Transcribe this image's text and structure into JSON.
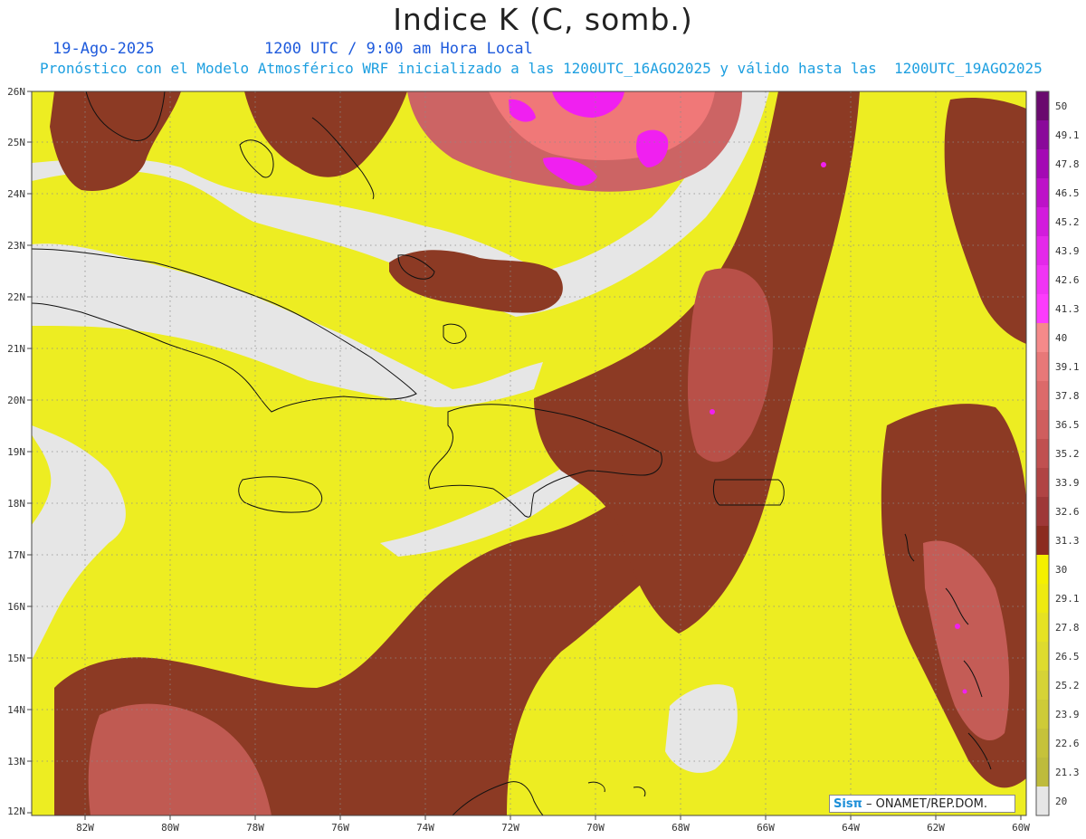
{
  "header": {
    "title": "Indice K (C, somb.)",
    "date": "19-Ago-2025",
    "time": "1200 UTC / 9:00 am Hora Local",
    "forecast_line": "Pronóstico con el Modelo Atmosférico WRF inicializado a las 1200UTC_16AGO2025 y válido hasta las  1200UTC_19AGO2025"
  },
  "axes": {
    "latitudes": [
      "26N",
      "25N",
      "24N",
      "23N",
      "22N",
      "21N",
      "20N",
      "19N",
      "18N",
      "17N",
      "16N",
      "15N",
      "14N",
      "13N",
      "12N"
    ],
    "longitudes": [
      "82W",
      "80W",
      "78W",
      "76W",
      "74W",
      "72W",
      "70W",
      "68W",
      "66W",
      "64W",
      "62W",
      "60W"
    ]
  },
  "colorbar": {
    "labels": [
      "50",
      "49.1",
      "47.8",
      "46.5",
      "45.2",
      "43.9",
      "42.6",
      "41.3",
      "40",
      "39.1",
      "37.8",
      "36.5",
      "35.2",
      "33.9",
      "32.6",
      "31.3",
      "30",
      "29.1",
      "27.8",
      "26.5",
      "25.2",
      "23.9",
      "22.6",
      "21.3",
      "20"
    ],
    "colors": [
      "#6a0a6e",
      "#8a0a9a",
      "#a40ab4",
      "#bd12c8",
      "#d21cdc",
      "#e428ea",
      "#f034f4",
      "#fc3cfc",
      "#f58a8a",
      "#e87878",
      "#dc6a6a",
      "#cf5e5e",
      "#c05050",
      "#b04444",
      "#9e3838",
      "#8c2c20",
      "#f4f000",
      "#eeea10",
      "#e6e222",
      "#dedb2e",
      "#d6d336",
      "#cecb38",
      "#c6c23a",
      "#bebb3c",
      "#e6e6e6"
    ]
  },
  "credit": {
    "logo": "Sisπ",
    "text": " – ONAMET/REP.DOM."
  },
  "colors": {
    "no_data": "#e6e6e6",
    "low": "#eded22",
    "mid": "#8c3a24",
    "high": "#cc6464",
    "peak": "#f07878",
    "extreme": "#f020f0"
  }
}
